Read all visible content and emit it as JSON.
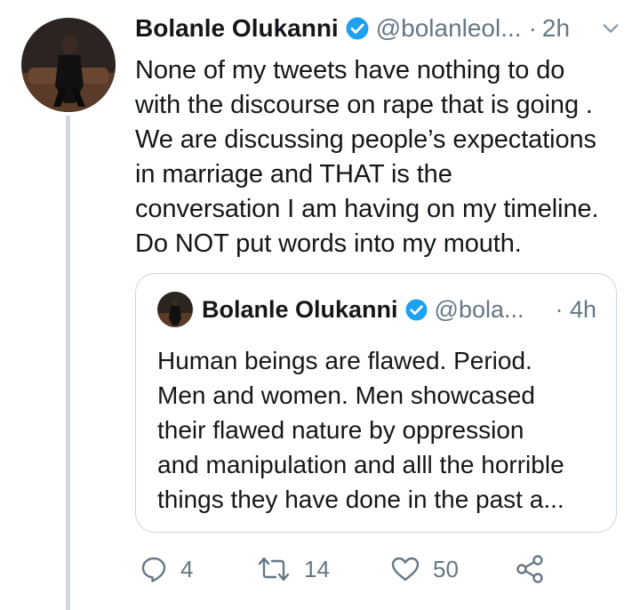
{
  "tweet": {
    "author_name": "Bolanle Olukanni",
    "author_handle": "@bolanleol...",
    "separator": "·",
    "time": "2h",
    "text": "None of my tweets have nothing to do\nwith the discourse on rape that is going .\nWe are discussing people’s expectations\nin marriage and THAT is the\nconversation I am having on my timeline.\nDo NOT put words into my mouth."
  },
  "quoted_tweet": {
    "author_name": "Bolanle Olukanni",
    "author_handle": "@bola...",
    "separator": "·",
    "time": "4h",
    "text": "Human beings are flawed. Period.\nMen and women. Men showcased\ntheir flawed nature by oppression\nand manipulation and alll the horrible\nthings they have done in the past a..."
  },
  "actions": {
    "reply_count": "4",
    "retweet_count": "14",
    "like_count": "50"
  },
  "icons": {
    "verified": "verified-badge-icon",
    "caret": "chevron-down-icon",
    "reply": "reply-icon",
    "retweet": "retweet-icon",
    "like": "heart-icon",
    "share": "share-icon"
  },
  "colors": {
    "text": "#14171a",
    "secondary": "#657786",
    "verified_blue": "#1da1f2",
    "border": "#ccd6dd"
  }
}
